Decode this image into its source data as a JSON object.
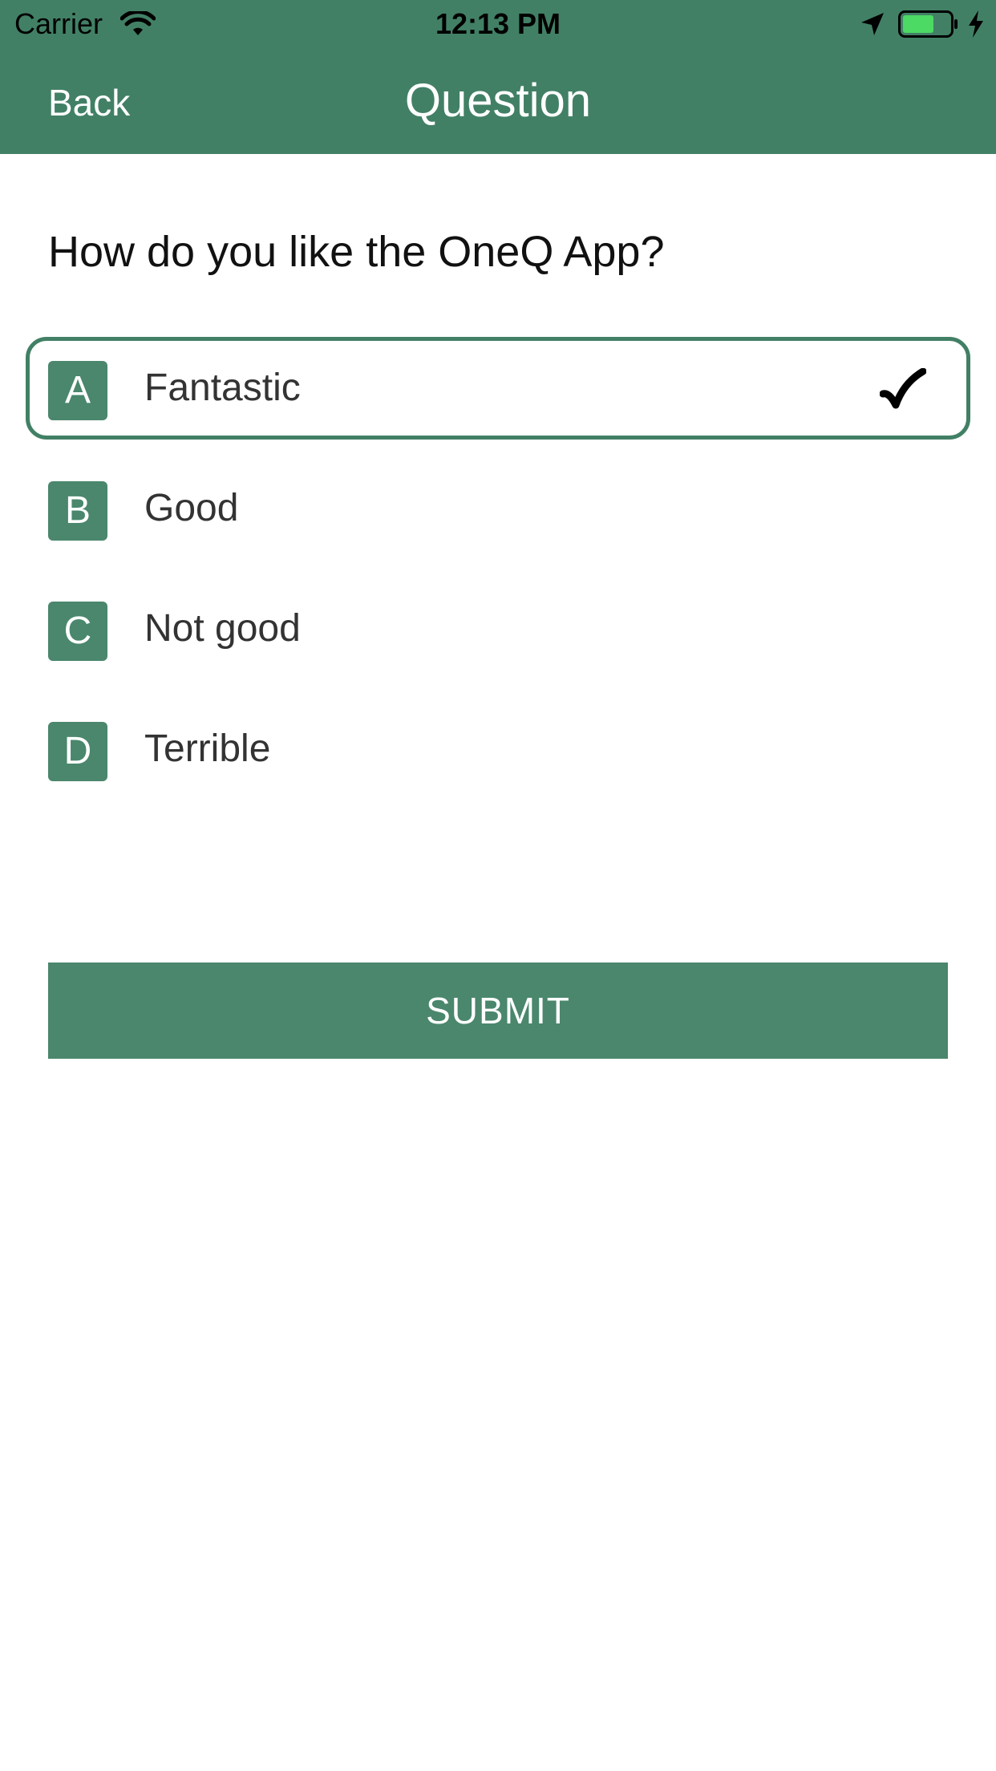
{
  "status_bar": {
    "carrier": "Carrier",
    "time": "12:13 PM",
    "battery_color": "#4cd964"
  },
  "nav": {
    "back_label": "Back",
    "title": "Question",
    "background_color": "#428066"
  },
  "question": {
    "text": "How do you like the OneQ App?"
  },
  "options": [
    {
      "letter": "A",
      "label": "Fantastic",
      "selected": true
    },
    {
      "letter": "B",
      "label": "Good",
      "selected": false
    },
    {
      "letter": "C",
      "label": "Not good",
      "selected": false
    },
    {
      "letter": "D",
      "label": "Terrible",
      "selected": false
    }
  ],
  "selected_icon": "checkmark-icon",
  "submit": {
    "label": "SUBMIT"
  },
  "accent_color": "#4a876d"
}
